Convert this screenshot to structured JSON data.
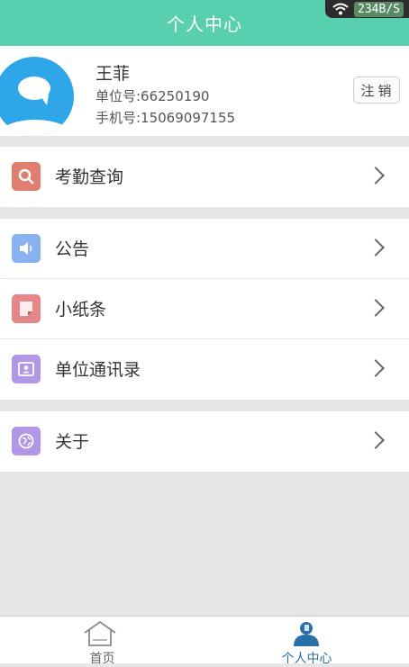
{
  "header": {
    "title": "个人中心"
  },
  "status_bar": {
    "speed": "234B/S"
  },
  "profile": {
    "name": "王菲",
    "unit_number": "单位号:66250190",
    "phone": "手机号:15069097155",
    "logout_label": "注销"
  },
  "menu": {
    "attendance": {
      "label": "考勤查询",
      "icon": "search-icon",
      "color": "#e07f6f"
    },
    "notice": {
      "label": "公告",
      "icon": "speaker-icon",
      "color": "#8bb2f0"
    },
    "note": {
      "label": "小纸条",
      "icon": "note-icon",
      "color": "#e58787"
    },
    "contacts": {
      "label": "单位通讯录",
      "icon": "contacts-icon",
      "color": "#b197e6"
    },
    "about": {
      "label": "关于",
      "icon": "globe-icon",
      "color": "#b197e6"
    }
  },
  "tabbar": {
    "home": {
      "label": "首页",
      "color": "#666666"
    },
    "profile": {
      "label": "个人中心",
      "color": "#2a6fa8"
    }
  }
}
